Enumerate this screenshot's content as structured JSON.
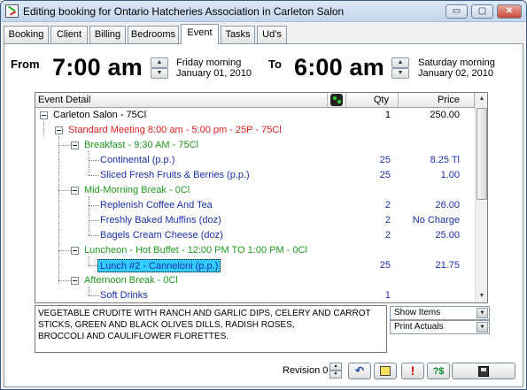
{
  "window": {
    "title": "Editing booking for Ontario Hatcheries Association in Carleton Salon",
    "min_glyph": "▭",
    "max_glyph": "▢",
    "close_glyph": "✕"
  },
  "tabs": [
    "Booking",
    "Client",
    "Billing",
    "Bedrooms",
    "Event",
    "Tasks",
    "Ud's"
  ],
  "active_tab": "Event",
  "event": {
    "from_label": "From",
    "from_time": "7:00 am",
    "from_day": "Friday morning",
    "from_date": "January 01, 2010",
    "to_label": "To",
    "to_time": "6:00 am",
    "to_day": "Saturday morning",
    "to_date": "January 02, 2010"
  },
  "grid": {
    "headers": {
      "detail": "Event Detail",
      "qty": "Qty",
      "price": "Price"
    },
    "rows": [
      {
        "label": "Carleton Salon - 75Cl",
        "qty": "1",
        "price": "250.00",
        "color": "#000000",
        "bold": true
      },
      {
        "label": "Standard Meeting 8:00 am - 5:00 pm - 25P - 75Cl",
        "qty": "",
        "price": "",
        "color": "#e02020",
        "bold": false
      },
      {
        "label": "Breakfast - 9:30 AM - 75Cl",
        "qty": "",
        "price": "",
        "color": "#1e9a1e",
        "bold": false
      },
      {
        "label": "Continental (p.p.)",
        "qty": "25",
        "price": "8.25 Tl",
        "color": "#1a2fb0",
        "bold": false
      },
      {
        "label": "Sliced Fresh Fruits & Berries (p.p.)",
        "qty": "25",
        "price": "1.00",
        "color": "#1a2fb0",
        "bold": false
      },
      {
        "label": "Mid-Morning Break - 0Cl",
        "qty": "",
        "price": "",
        "color": "#1e9a1e",
        "bold": false
      },
      {
        "label": "Replenish Coffee And Tea",
        "qty": "2",
        "price": "26.00",
        "color": "#1a2fb0",
        "bold": false
      },
      {
        "label": "Freshly Baked Muffins (doz)",
        "qty": "2",
        "price": "No Charge",
        "color": "#1a2fb0",
        "bold": false
      },
      {
        "label": "Bagels Cream Cheese (doz)",
        "qty": "2",
        "price": "25.00",
        "color": "#1a2fb0",
        "bold": false
      },
      {
        "label": "Luncheon - Hot Buffet - 12:00 PM TO 1:00 PM - 0Cl",
        "qty": "",
        "price": "",
        "color": "#1e9a1e",
        "bold": false
      },
      {
        "label": "Lunch #2 - Canneloni (p.p.)",
        "qty": "25",
        "price": "21.75",
        "color": "#1a2fb0",
        "bold": false,
        "selected": true
      },
      {
        "label": "Afternoon Break - 0Cl",
        "qty": "",
        "price": "",
        "color": "#1e9a1e",
        "bold": false
      },
      {
        "label": "Soft Drinks",
        "qty": "1",
        "price": "",
        "color": "#1a2fb0",
        "bold": false
      }
    ]
  },
  "notes": "VEGETABLE CRUDITE WITH RANCH AND GARLIC DIPS, CELERY AND CARROT STICKS, GREEN AND BLACK OLIVES DILLS, RADISH ROSES,\nBROCCOLI AND CAULIFLOWER FLORETTES.",
  "show_items": "Show Items",
  "print_actuals": "Print Actuals",
  "revision_label": "Revision 0",
  "icons": {
    "undo": "↶",
    "alert": "!",
    "price": "?$"
  }
}
